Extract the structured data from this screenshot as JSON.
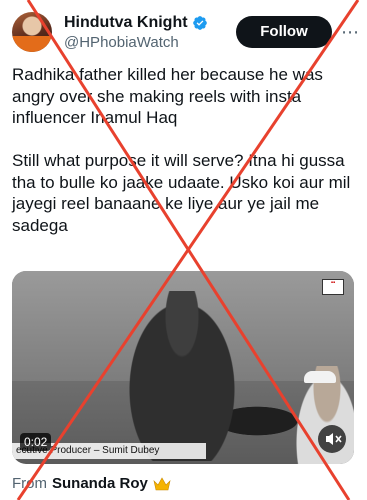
{
  "author": {
    "display_name": "Hindutva Knight",
    "handle": "@HPhobiaWatch",
    "verified_icon": "verified-badge-icon",
    "accent": "#1d9bf0"
  },
  "actions": {
    "follow_label": "Follow",
    "more_icon": "more-options-icon"
  },
  "tweet": {
    "text": "Radhika father killed her because he was angry over she making reels with insta influencer Inamul Haq\n\nStill what purpose it will serve? Itna hi gussa tha to bulle ko jaake udaate. Usko koi aur mil jayegi reel banaane ke liye aur ye jail me sadega"
  },
  "media": {
    "timecode": "0:02",
    "caption": "ecutive Producer – Sumit Dubey",
    "mute_icon": "muted-speaker-icon"
  },
  "attribution": {
    "from_label": "From",
    "name": "Sunanda Roy",
    "crown_icon": "crown-icon"
  },
  "overlay": {
    "cross_color": "#e8412e"
  }
}
